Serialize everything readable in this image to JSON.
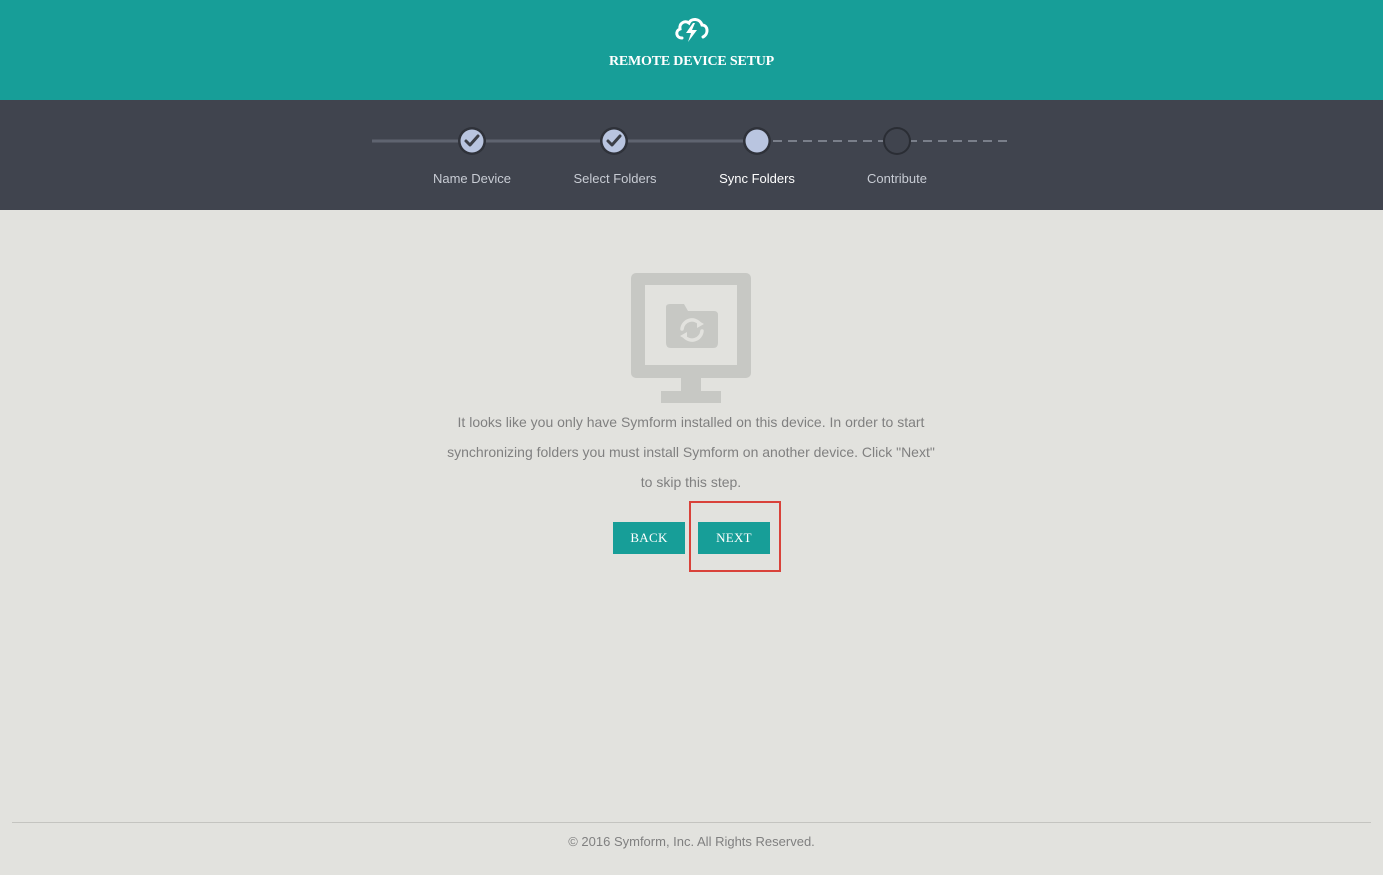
{
  "header": {
    "logo_icon": "cloud-bolt-icon",
    "title": "REMOTE DEVICE SETUP",
    "background": "#179e98"
  },
  "steps": {
    "items": [
      {
        "label": "Name Device",
        "state": "completed",
        "icon": "checkmark-icon"
      },
      {
        "label": "Select Folders",
        "state": "completed",
        "icon": "checkmark-icon"
      },
      {
        "label": "Sync Folders",
        "state": "current",
        "icon": ""
      },
      {
        "label": "Contribute",
        "state": "pending",
        "icon": ""
      }
    ],
    "background": "#40444e"
  },
  "main": {
    "illustration_icon": "monitor-sync-folder-icon",
    "message": "It looks like you only have Symform installed on this device. In order to start synchronizing folders you must install Symform on another device. Click \"Next\" to skip this step.",
    "back_label": "BACK",
    "next_label": "NEXT",
    "accent": "#179e98",
    "highlight_color": "#d9423a"
  },
  "footer": {
    "copyright": "© 2016 Symform, Inc. All Rights Reserved."
  }
}
